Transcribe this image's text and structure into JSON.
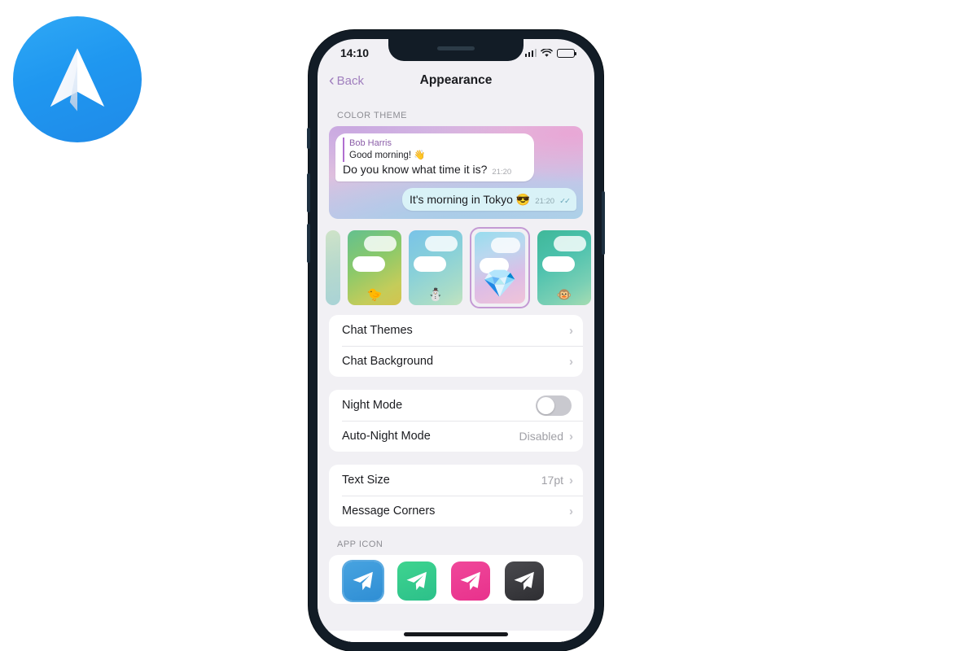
{
  "logo": {
    "name": "paper-plane-logo",
    "bg_color": "#1f97f0"
  },
  "phone": {
    "status_bar": {
      "time": "14:10",
      "signal_icon": "cellular-signal-icon",
      "wifi_icon": "wifi-icon",
      "battery_icon": "battery-icon"
    },
    "navbar": {
      "back_label": "Back",
      "back_chevron": "‹",
      "title": "Appearance",
      "accent_color": "#a07fbe"
    },
    "sections": {
      "color_theme_header": "COLOR THEME",
      "app_icon_header": "APP ICON"
    },
    "preview": {
      "reply_name": "Bob Harris",
      "reply_text": "Good morning! 👋",
      "incoming_text": "Do you know what time it is?",
      "incoming_time": "21:20",
      "outgoing_text": "It's morning in Tokyo 😎",
      "outgoing_time": "21:20",
      "outgoing_ticks": "✓✓"
    },
    "themes": [
      {
        "name": "theme-green",
        "emoji": "🐤",
        "selected": false
      },
      {
        "name": "theme-blue",
        "emoji": "⛄",
        "selected": false
      },
      {
        "name": "theme-diamond",
        "emoji": "💎",
        "selected": true
      },
      {
        "name": "theme-teal",
        "emoji": "🐵",
        "selected": false
      }
    ],
    "rows": {
      "chat_themes": "Chat Themes",
      "chat_background": "Chat Background",
      "night_mode": "Night Mode",
      "night_mode_on": false,
      "auto_night_mode": "Auto-Night Mode",
      "auto_night_mode_value": "Disabled",
      "text_size": "Text Size",
      "text_size_value": "17pt",
      "message_corners": "Message Corners",
      "chevron": "›"
    },
    "app_icons": [
      {
        "name": "app-icon-blue",
        "selected": true
      },
      {
        "name": "app-icon-green",
        "selected": false
      },
      {
        "name": "app-icon-pink",
        "selected": false
      },
      {
        "name": "app-icon-dark",
        "selected": false
      }
    ]
  }
}
